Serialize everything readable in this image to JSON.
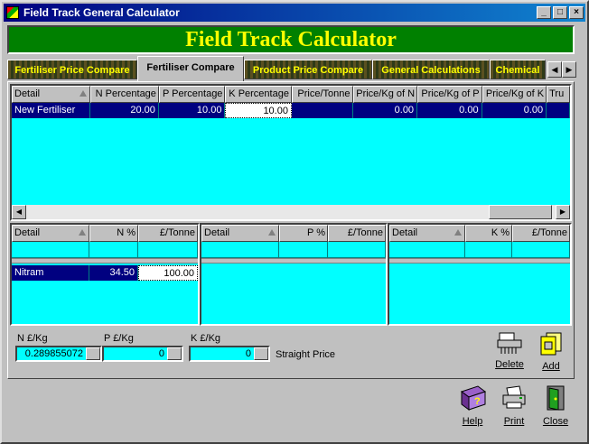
{
  "window": {
    "title": "Field Track General Calculator"
  },
  "banner": {
    "title": "Field Track Calculator"
  },
  "tabs": [
    {
      "label": "Fertiliser Price Compare"
    },
    {
      "label": "Fertiliser Compare"
    },
    {
      "label": "Product Price Compare"
    },
    {
      "label": "General Calculations"
    },
    {
      "label": "Chemical"
    }
  ],
  "main_grid": {
    "columns": [
      "Detail",
      "N Percentage",
      "P Percentage",
      "K Percentage",
      "Price/Tonne",
      "Price/Kg of N",
      "Price/Kg of P",
      "Price/Kg of K",
      "Tru"
    ],
    "rows": [
      [
        "New Fertiliser",
        "20.00",
        "10.00",
        "10.00",
        "",
        "0.00",
        "0.00",
        "0.00",
        ""
      ]
    ]
  },
  "n_grid": {
    "columns": [
      "Detail",
      "N %",
      "£/Tonne"
    ],
    "row": [
      "Nitram",
      "34.50",
      "100.00"
    ]
  },
  "p_grid": {
    "columns": [
      "Detail",
      "P %",
      "£/Tonne"
    ]
  },
  "k_grid": {
    "columns": [
      "Detail",
      "K %",
      "£/Tonne"
    ]
  },
  "fields": {
    "n_label": "N £/Kg",
    "n_value": "0.289855072",
    "p_label": "P £/Kg",
    "p_value": "0",
    "k_label": "K £/Kg",
    "k_value": "0",
    "straight_label": "Straight Price"
  },
  "buttons": {
    "delete": "Delete",
    "add": "Add",
    "help": "Help",
    "print": "Print",
    "close": "Close"
  }
}
